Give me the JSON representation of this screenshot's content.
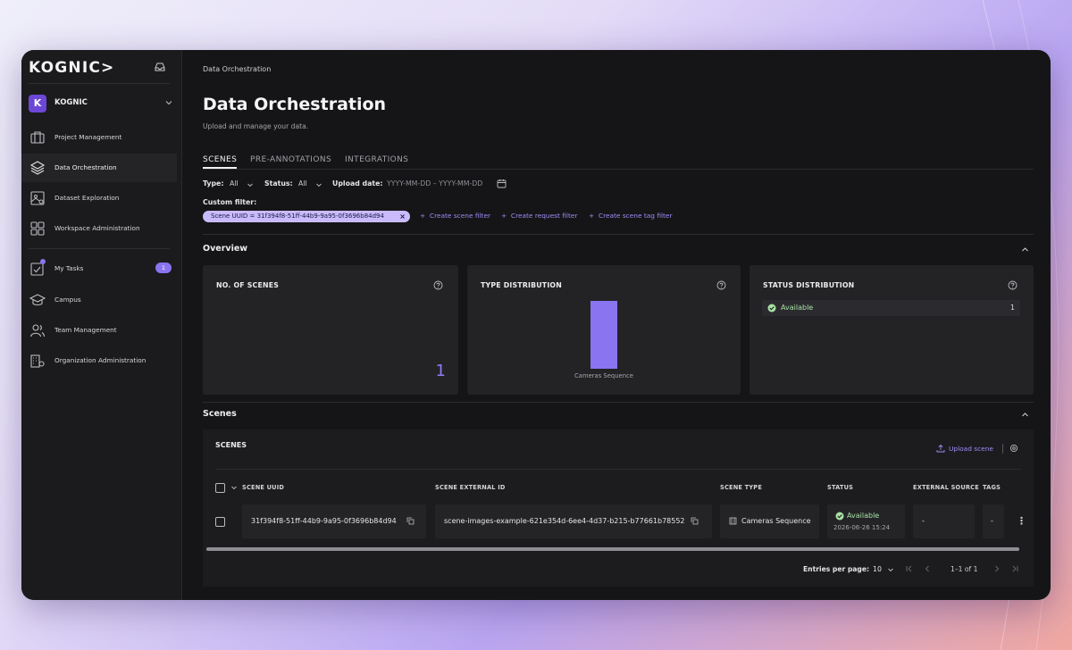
{
  "sidebar": {
    "logo": "KOGNIC>",
    "org_initial": "K",
    "org_name": "KOGNIC",
    "items": [
      {
        "label": "Project Management"
      },
      {
        "label": "Data Orchestration"
      },
      {
        "label": "Dataset Exploration"
      },
      {
        "label": "Workspace Administration"
      },
      {
        "label": "My Tasks",
        "count": "1"
      },
      {
        "label": "Campus"
      },
      {
        "label": "Team Management"
      },
      {
        "label": "Organization Administration"
      }
    ]
  },
  "header": {
    "breadcrumb": "Data Orchestration",
    "title": "Data Orchestration",
    "subtitle": "Upload and manage your data."
  },
  "tabs": [
    {
      "label": "SCENES"
    },
    {
      "label": "PRE-ANNOTATIONS"
    },
    {
      "label": "INTEGRATIONS"
    }
  ],
  "filters": {
    "type_label": "Type:",
    "type_value": "All",
    "status_label": "Status:",
    "status_value": "All",
    "upload_label": "Upload date:",
    "date_placeholder": "YYYY-MM-DD – YYYY-MM-DD",
    "custom_label": "Custom filter:",
    "chip_text": "Scene UUID = 31f394f8-51ff-44b9-9a95-0f3696b84d94",
    "add_links": [
      "Create scene filter",
      "Create request filter",
      "Create scene tag filter"
    ]
  },
  "overview": {
    "title": "Overview",
    "cards": {
      "scenes_title": "NO. OF SCENES",
      "scenes_count": "1",
      "type_title": "TYPE DISTRIBUTION",
      "status_title": "STATUS DISTRIBUTION"
    },
    "status_rows": [
      {
        "label": "Available",
        "count": "1"
      }
    ]
  },
  "chart_data": {
    "type": "bar",
    "categories": [
      "Cameras Sequence"
    ],
    "values": [
      1
    ],
    "ylim": [
      0,
      1
    ],
    "color": "#8b74f0"
  },
  "scenes": {
    "section_title": "Scenes",
    "panel_title": "SCENES",
    "upload_label": "Upload scene",
    "columns": [
      "SCENE UUID",
      "SCENE EXTERNAL ID",
      "SCENE TYPE",
      "STATUS",
      "EXTERNAL SOURCE",
      "TAGS"
    ],
    "rows": [
      {
        "uuid": "31f394f8-51ff-44b9-9a95-0f3696b84d94",
        "external_id": "scene-images-example-621e354d-6ee4-4d37-b215-b77661b78552",
        "type": "Cameras Sequence",
        "status": "Available",
        "status_date": "2026-06-26 15:24",
        "external_source": "-",
        "tags": "-"
      }
    ],
    "pager": {
      "entries_label": "Entries per page:",
      "entries_value": "10",
      "range": "1–1 of 1"
    }
  },
  "colors": {
    "accent": "#8b74f0",
    "success": "#a8e0a5",
    "chip_bg": "#c9bbfb"
  }
}
